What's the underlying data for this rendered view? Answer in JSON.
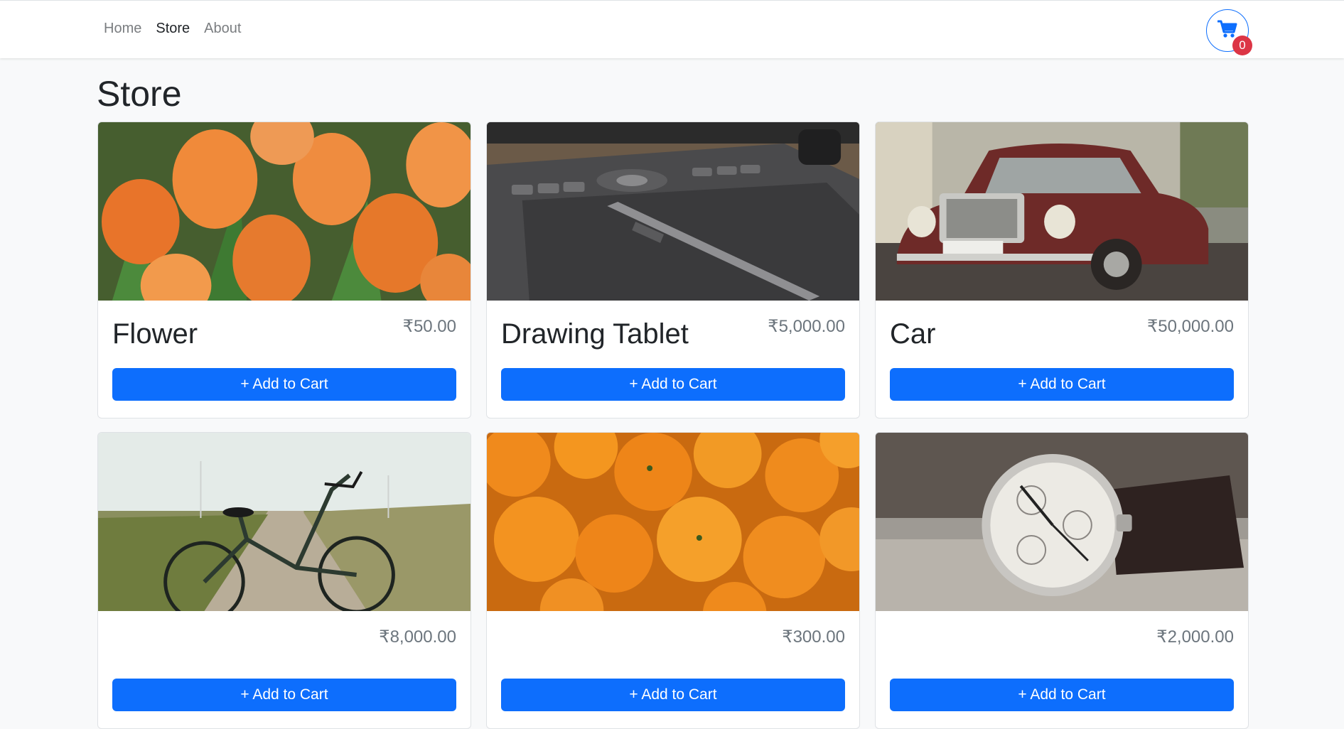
{
  "nav": {
    "links": [
      "Home",
      "Store",
      "About"
    ],
    "active_index": 1,
    "cart_icon": "shopping-cart-icon",
    "cart_count": "0"
  },
  "page": {
    "title": "Store"
  },
  "products": [
    {
      "name": "Flower",
      "price": "₹50.00",
      "button": "+ Add to Cart",
      "image": "orange tulips"
    },
    {
      "name": "Drawing Tablet",
      "price": "₹5,000.00",
      "button": "+ Add to Cart",
      "image": "pen tablet with stylus"
    },
    {
      "name": "Car",
      "price": "₹50,000.00",
      "button": "+ Add to Cart",
      "image": "vintage red car"
    },
    {
      "name": "",
      "price": "₹8,000.00",
      "button": "+ Add to Cart",
      "image": "bicycle on country road"
    },
    {
      "name": "",
      "price": "₹300.00",
      "button": "+ Add to Cart",
      "image": "pile of oranges"
    },
    {
      "name": "",
      "price": "₹2,000.00",
      "button": "+ Add to Cart",
      "image": "wristwatch"
    }
  ],
  "colors": {
    "primary": "#0d6efd",
    "badge": "#dc3545",
    "background": "#f8f9fa"
  }
}
